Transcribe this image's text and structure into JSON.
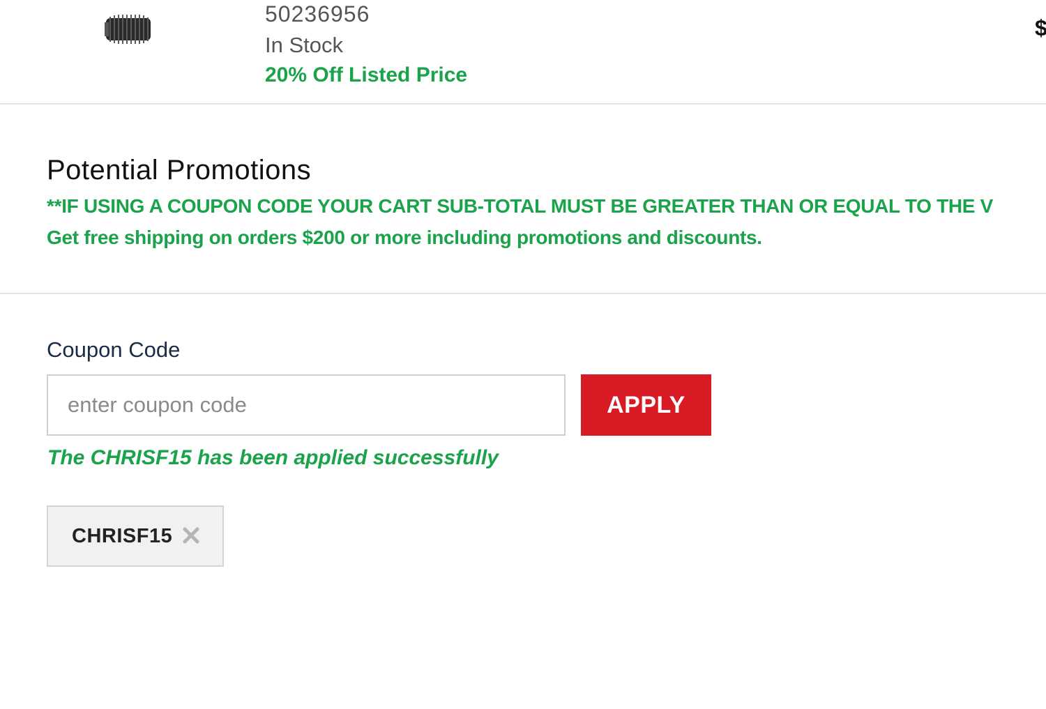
{
  "product": {
    "image_icon": "spring-part-icon",
    "sku": "50236956",
    "stock_status": "In Stock",
    "discount_text": "20% Off Listed Price",
    "price_fragment": "$"
  },
  "promotions": {
    "title": "Potential Promotions",
    "lines": [
      "**IF USING A COUPON CODE YOUR CART SUB-TOTAL MUST BE GREATER THAN OR EQUAL TO THE V",
      "Get free shipping on orders $200 or more including promotions and discounts."
    ]
  },
  "coupon": {
    "label": "Coupon Code",
    "input_value": "",
    "input_placeholder": "enter coupon code",
    "apply_label": "APPLY",
    "success_message": "The CHRISF15 has been applied successfully",
    "applied_code": "CHRISF15",
    "remove_icon": "close-icon"
  },
  "colors": {
    "success_green": "#1aa34a",
    "apply_red": "#d81a25",
    "text_dark": "#111111",
    "label_navy": "#1a2b44"
  }
}
